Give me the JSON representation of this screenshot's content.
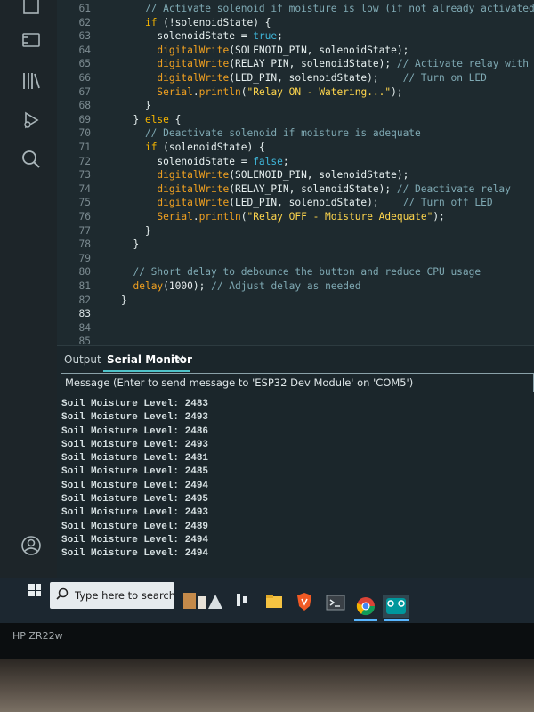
{
  "editor": {
    "lines": [
      {
        "n": "61",
        "tokens": [
          [
            "cm",
            "    // Activate solenoid if moisture is low (if not already activated)"
          ]
        ]
      },
      {
        "n": "62",
        "tokens": [
          [
            "id",
            "    "
          ],
          [
            "kw",
            "if"
          ],
          [
            "id",
            " (!solenoidState) {"
          ]
        ]
      },
      {
        "n": "63",
        "tokens": [
          [
            "id",
            "      solenoidState = "
          ],
          [
            "lit",
            "true"
          ],
          [
            "id",
            ";"
          ]
        ]
      },
      {
        "n": "64",
        "tokens": [
          [
            "id",
            "      "
          ],
          [
            "fn",
            "digitalWrite"
          ],
          [
            "id",
            "(SOLENOID_PIN, solenoidState);"
          ]
        ]
      },
      {
        "n": "65",
        "tokens": [
          [
            "id",
            "      "
          ],
          [
            "fn",
            "digitalWrite"
          ],
          [
            "id",
            "(RELAY_PIN, solenoidState); "
          ],
          [
            "cm",
            "// Activate relay with solenoid"
          ]
        ]
      },
      {
        "n": "66",
        "tokens": [
          [
            "id",
            "      "
          ],
          [
            "fn",
            "digitalWrite"
          ],
          [
            "id",
            "(LED_PIN, solenoidState);    "
          ],
          [
            "cm",
            "// Turn on LED"
          ]
        ]
      },
      {
        "n": "67",
        "tokens": [
          [
            "id",
            "      "
          ],
          [
            "fn",
            "Serial"
          ],
          [
            "id",
            "."
          ],
          [
            "fn",
            "println"
          ],
          [
            "id",
            "("
          ],
          [
            "str",
            "\"Relay ON - Watering...\""
          ],
          [
            "id",
            ");"
          ]
        ]
      },
      {
        "n": "68",
        "tokens": [
          [
            "id",
            "    }"
          ]
        ]
      },
      {
        "n": "69",
        "tokens": [
          [
            "id",
            "  } "
          ],
          [
            "kw",
            "else"
          ],
          [
            "id",
            " {"
          ]
        ]
      },
      {
        "n": "70",
        "tokens": [
          [
            "cm",
            "    // Deactivate solenoid if moisture is adequate"
          ]
        ]
      },
      {
        "n": "71",
        "tokens": [
          [
            "id",
            "    "
          ],
          [
            "kw",
            "if"
          ],
          [
            "id",
            " (solenoidState) {"
          ]
        ]
      },
      {
        "n": "72",
        "tokens": [
          [
            "id",
            "      solenoidState = "
          ],
          [
            "lit",
            "false"
          ],
          [
            "id",
            ";"
          ]
        ]
      },
      {
        "n": "73",
        "tokens": [
          [
            "id",
            "      "
          ],
          [
            "fn",
            "digitalWrite"
          ],
          [
            "id",
            "(SOLENOID_PIN, solenoidState);"
          ]
        ]
      },
      {
        "n": "74",
        "tokens": [
          [
            "id",
            "      "
          ],
          [
            "fn",
            "digitalWrite"
          ],
          [
            "id",
            "(RELAY_PIN, solenoidState); "
          ],
          [
            "cm",
            "// Deactivate relay"
          ]
        ]
      },
      {
        "n": "75",
        "tokens": [
          [
            "id",
            "      "
          ],
          [
            "fn",
            "digitalWrite"
          ],
          [
            "id",
            "(LED_PIN, solenoidState);    "
          ],
          [
            "cm",
            "// Turn off LED"
          ]
        ]
      },
      {
        "n": "76",
        "tokens": [
          [
            "id",
            "      "
          ],
          [
            "fn",
            "Serial"
          ],
          [
            "id",
            "."
          ],
          [
            "fn",
            "println"
          ],
          [
            "id",
            "("
          ],
          [
            "str",
            "\"Relay OFF - Moisture Adequate\""
          ],
          [
            "id",
            ");"
          ]
        ]
      },
      {
        "n": "77",
        "tokens": [
          [
            "id",
            "    }"
          ]
        ]
      },
      {
        "n": "78",
        "tokens": [
          [
            "id",
            "  }"
          ]
        ]
      },
      {
        "n": "79",
        "tokens": []
      },
      {
        "n": "80",
        "tokens": [
          [
            "cm",
            "  // Short delay to debounce the button and reduce CPU usage"
          ]
        ]
      },
      {
        "n": "81",
        "tokens": [
          [
            "id",
            "  "
          ],
          [
            "fn",
            "delay"
          ],
          [
            "id",
            "("
          ],
          [
            "num",
            "1000"
          ],
          [
            "id",
            "); "
          ],
          [
            "cm",
            "// Adjust delay as needed"
          ]
        ]
      },
      {
        "n": "82",
        "tokens": [
          [
            "id",
            "}"
          ]
        ]
      },
      {
        "n": "83",
        "tokens": [],
        "active": true
      },
      {
        "n": "84",
        "tokens": []
      },
      {
        "n": "85",
        "tokens": []
      }
    ]
  },
  "panel": {
    "tab_output": "Output",
    "tab_serial": "Serial Monitor",
    "close_glyph": "✕",
    "message_placeholder": "Message (Enter to send message to 'ESP32 Dev Module' on 'COM5')",
    "serial_lines": [
      "Soil Moisture Level: 2483",
      "Soil Moisture Level: 2493",
      "Soil Moisture Level: 2486",
      "Soil Moisture Level: 2493",
      "Soil Moisture Level: 2481",
      "Soil Moisture Level: 2485",
      "Soil Moisture Level: 2494",
      "Soil Moisture Level: 2495",
      "Soil Moisture Level: 2493",
      "Soil Moisture Level: 2489",
      "Soil Moisture Level: 2494",
      "Soil Moisture Level: 2494"
    ]
  },
  "taskbar": {
    "search_placeholder": "Type here to search",
    "apps": [
      "coffee-app-icon",
      "task-view-icon",
      "file-explorer-icon",
      "brave-browser-icon",
      "terminal-icon",
      "chrome-icon",
      "arduino-ide-icon"
    ]
  },
  "monitor": {
    "brand_label": "HP ZR22w"
  },
  "colors": {
    "accent": "#4fc3c9",
    "keyword": "#f4b400",
    "literal": "#3fb6d9",
    "comment": "#7fa9b3",
    "string": "#ffd64d"
  }
}
